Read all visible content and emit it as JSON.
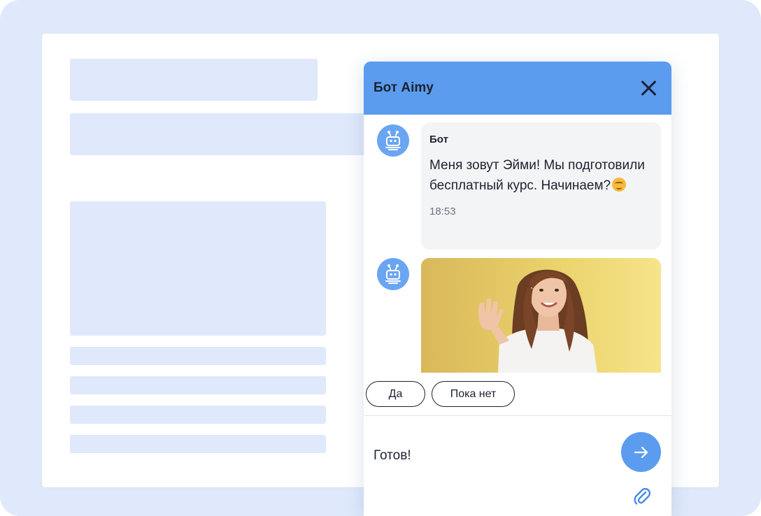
{
  "widget": {
    "title": "Бот Aimy"
  },
  "message": {
    "sender": "Бот",
    "text": "Меня зовут Эйми! Мы подготовили бесплатный курс. Начинаем?",
    "emoji": "face-with-rolling-eyes",
    "time": "18:53"
  },
  "photo": {
    "subject": "woman-waving"
  },
  "quick_replies": {
    "yes": "Да",
    "not_yet": "Пока нет"
  },
  "composer": {
    "value": "Готов!"
  },
  "icons": {
    "avatar": "robot-icon",
    "close": "close-icon",
    "send": "arrow-right-icon",
    "attach": "paperclip-icon"
  },
  "colors": {
    "background": "#dfe9fb",
    "accent": "#5b9cef",
    "placeholder": "#dfe9fb",
    "bubble": "#f3f4f5"
  }
}
